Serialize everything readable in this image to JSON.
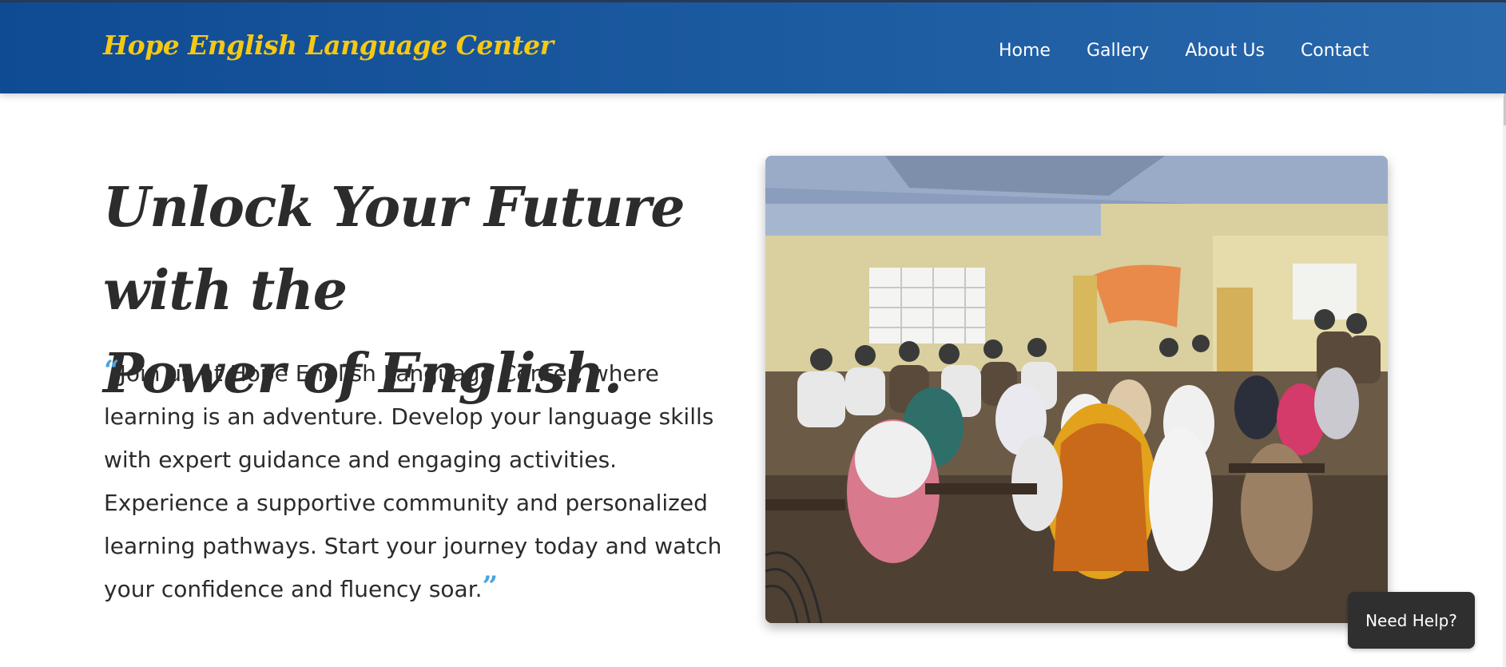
{
  "header": {
    "brand": "Hope English Language Center",
    "nav": [
      {
        "label": "Home"
      },
      {
        "label": "Gallery"
      },
      {
        "label": "About Us"
      },
      {
        "label": "Contact"
      }
    ]
  },
  "hero": {
    "headline_line1": "Unlock Your Future with the",
    "headline_line2": "Power of English.",
    "quote_open": "“",
    "intro_text": "Join us at Hope English Language Center, where learning is an adventure. Develop your language skills with expert guidance and engaging activities. Experience a supportive community and personalized learning pathways. Start your journey today and watch your confidence and fluency soar.",
    "quote_close": "”"
  },
  "help": {
    "label": "Need Help?"
  },
  "colors": {
    "navbar": "#1c5aa0",
    "brand": "#f5c814",
    "quote_marks": "#4aa3e0",
    "help_button": "#2f2f2f"
  }
}
